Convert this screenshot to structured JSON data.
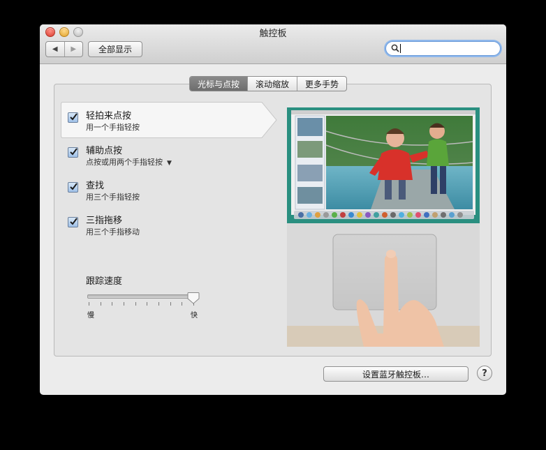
{
  "window": {
    "title": "触控板"
  },
  "toolbar": {
    "back_icon": "◀",
    "forward_icon": "▶",
    "show_all_label": "全部显示",
    "search_value": ""
  },
  "tabs": [
    {
      "label": "光标与点按",
      "active": true
    },
    {
      "label": "滚动缩放",
      "active": false
    },
    {
      "label": "更多手势",
      "active": false
    }
  ],
  "gestures": [
    {
      "title": "轻拍来点按",
      "subtitle": "用一个手指轻按",
      "checked": true
    },
    {
      "title": "辅助点按",
      "subtitle": "点按或用两个手指轻按",
      "checked": true,
      "has_dropdown": true
    },
    {
      "title": "查找",
      "subtitle": "用三个手指轻按",
      "checked": true
    },
    {
      "title": "三指拖移",
      "subtitle": "用三个手指移动",
      "checked": true
    }
  ],
  "tracking": {
    "label": "跟踪速度",
    "min_label": "慢",
    "max_label": "快",
    "value": 1.0
  },
  "footer": {
    "bluetooth_button": "设置蓝牙触控板…",
    "help_label": "?"
  },
  "colors": {
    "accent": "#6b9bd8",
    "active_tab": "#7a7a7a",
    "checkbox": "#9fc0e8"
  }
}
